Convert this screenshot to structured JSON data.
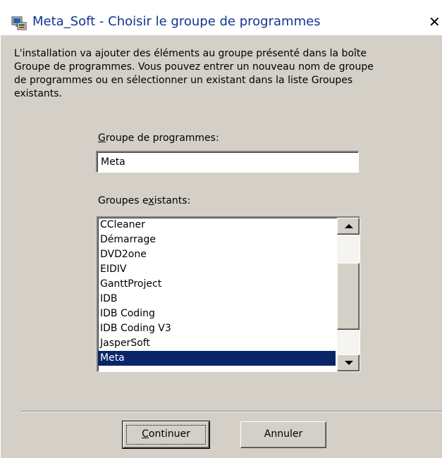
{
  "window": {
    "title": "Meta_Soft - Choisir le groupe de programmes",
    "close_glyph": "✕",
    "icon": "setup-icon"
  },
  "description": "L'installation va ajouter des éléments au groupe présenté dans la boîte\nGroupe de programmes. Vous pouvez entrer un nouveau nom de groupe\nde programmes ou en sélectionner un existant dans la liste Groupes\nexistants.",
  "group_field": {
    "label_accel": "G",
    "label_rest": "roupe de programmes:",
    "value": "Meta"
  },
  "existing_groups": {
    "label_before": "Groupes e",
    "label_accel": "x",
    "label_after": "istants:",
    "items": [
      "CCleaner",
      "Démarrage",
      "DVD2one",
      "EIDIV",
      "GanttProject",
      "IDB",
      "IDB Coding",
      "IDB Coding V3",
      "JasperSoft",
      "Meta"
    ],
    "selected": "Meta"
  },
  "buttons": {
    "continue_accel": "C",
    "continue_rest": "ontinuer",
    "cancel": "Annuler"
  },
  "colors": {
    "title_text": "#11348f",
    "dialog_face": "#d4d0c8",
    "selection": "#0a246a"
  }
}
